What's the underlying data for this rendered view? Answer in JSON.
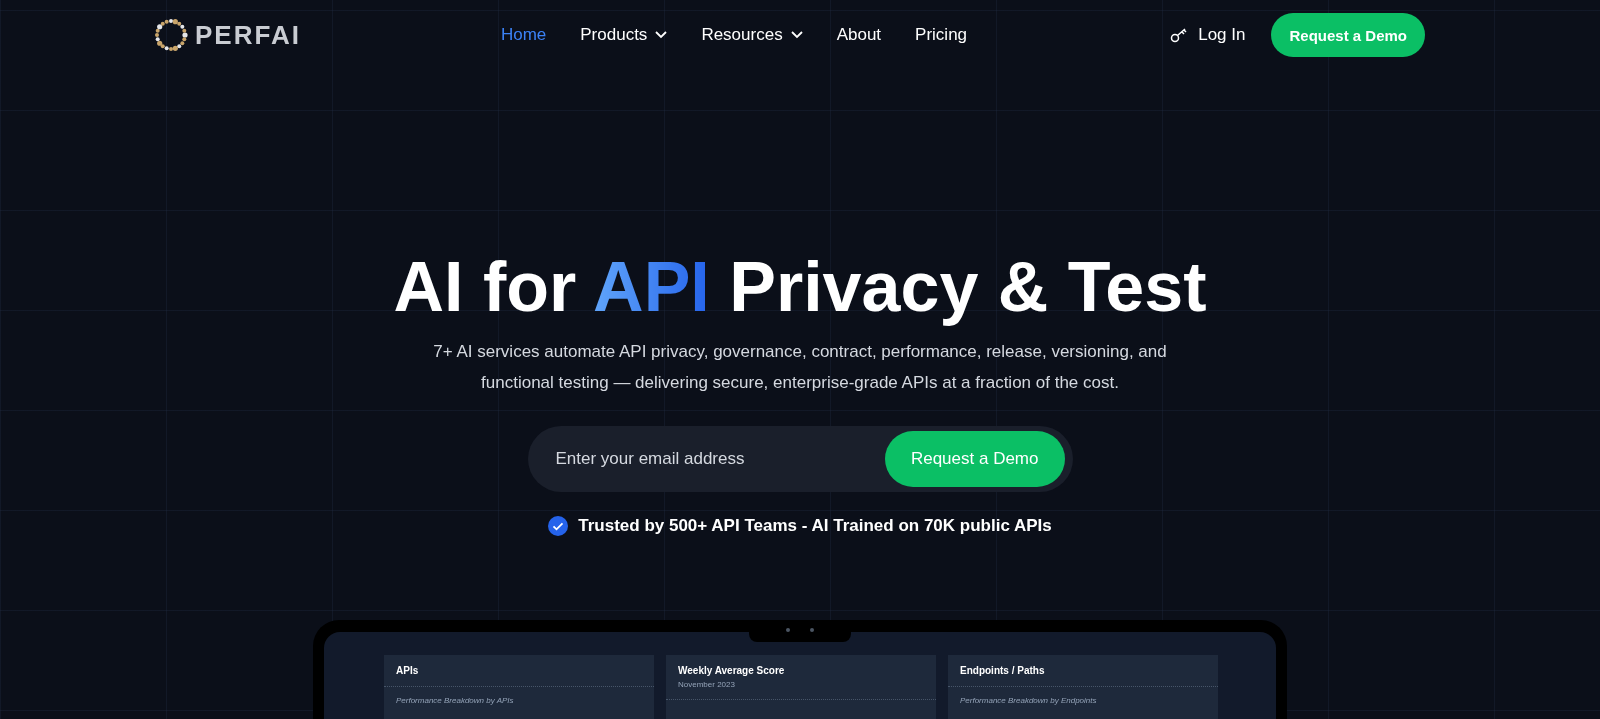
{
  "header": {
    "logo_text": "PERFAI",
    "nav": [
      {
        "label": "Home",
        "selected": true,
        "dropdown": false
      },
      {
        "label": "Products",
        "selected": false,
        "dropdown": true
      },
      {
        "label": "Resources",
        "selected": false,
        "dropdown": true
      },
      {
        "label": "About",
        "selected": false,
        "dropdown": false
      },
      {
        "label": "Pricing",
        "selected": false,
        "dropdown": false
      }
    ],
    "login": "Log In",
    "cta": "Request a Demo"
  },
  "hero": {
    "title_before": "AI for ",
    "title_highlight": "API",
    "title_after": " Privacy & Test",
    "subtitle": "7+ AI services automate API privacy, governance, contract, performance, release, versioning, and functional testing — delivering secure, enterprise-grade APIs at a fraction of the cost.",
    "email": {
      "placeholder": "Enter your email address"
    },
    "submit": "Request a Demo",
    "trust": "Trusted by 500+ API Teams - AI Trained on 70K public APIs"
  },
  "dashboard": {
    "cards": [
      {
        "title": "APIs",
        "caption": "Performance Breakdown by APIs"
      },
      {
        "title": "Weekly Average Score",
        "subtitle": "November 2023"
      },
      {
        "title": "Endpoints / Paths",
        "caption": "Performance Breakdown by Endpoints"
      }
    ]
  }
}
